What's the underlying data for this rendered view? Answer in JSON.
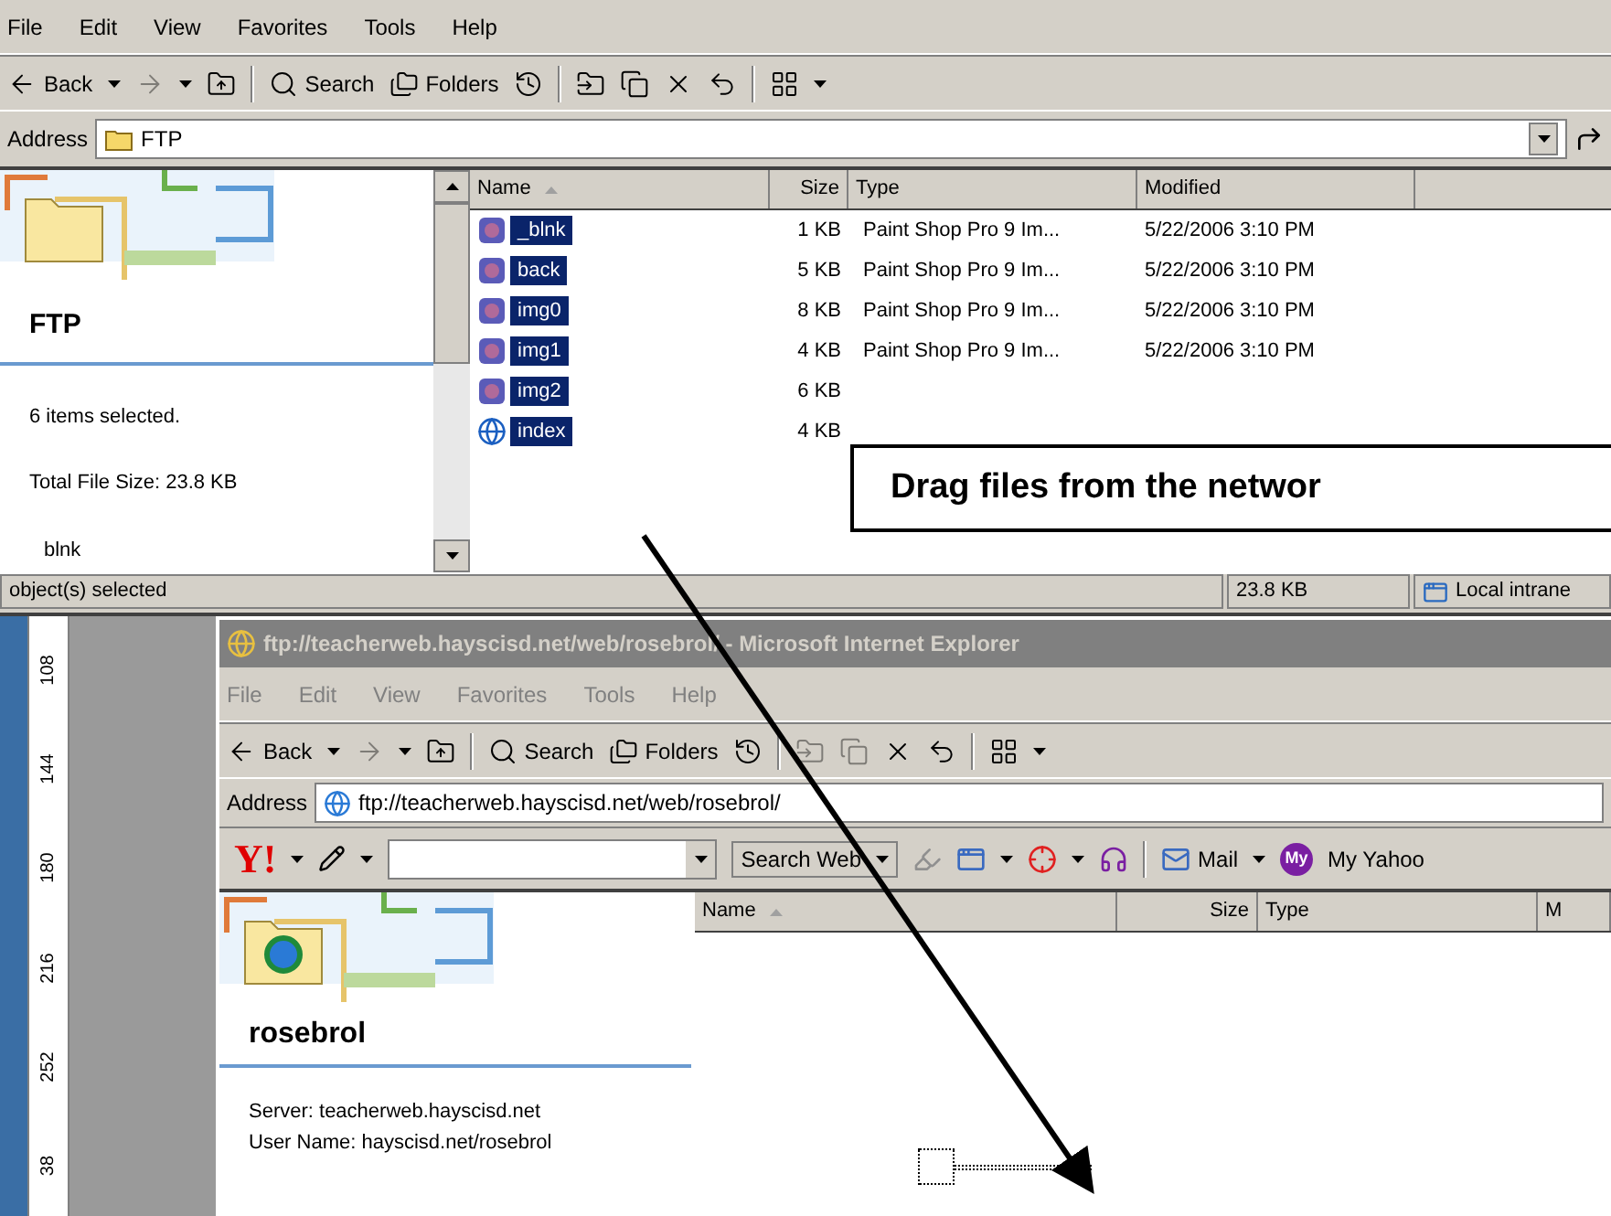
{
  "explorer": {
    "menu": [
      {
        "label": "File",
        "disabled": false
      },
      {
        "label": "Edit",
        "disabled": false
      },
      {
        "label": "View",
        "disabled": false
      },
      {
        "label": "Favorites",
        "disabled": false
      },
      {
        "label": "Tools",
        "disabled": false
      },
      {
        "label": "Help",
        "disabled": false
      }
    ],
    "toolbar": [
      {
        "kind": "back",
        "label": "Back",
        "disabled": false
      },
      {
        "kind": "forward",
        "disabled": true
      },
      {
        "kind": "up",
        "disabled": false
      },
      {
        "kind": "search",
        "label": "Search",
        "disabled": false
      },
      {
        "kind": "folders",
        "label": "Folders",
        "disabled": false
      },
      {
        "kind": "history",
        "disabled": false
      },
      {
        "kind": "move",
        "disabled": false
      },
      {
        "kind": "copy",
        "disabled": false
      },
      {
        "kind": "delete",
        "disabled": false
      },
      {
        "kind": "undo",
        "disabled": false
      },
      {
        "kind": "views",
        "disabled": false
      }
    ],
    "address": {
      "label": "Address",
      "value": "FTP"
    },
    "task_pane": {
      "title": "FTP",
      "details": [
        "6 items selected.",
        "Total File Size: 23.8 KB"
      ],
      "file_label": "blnk"
    },
    "file_list": {
      "columns": [
        {
          "label": "Name",
          "sorted": true
        },
        {
          "label": "Size",
          "sorted": false
        },
        {
          "label": "Type",
          "sorted": false
        },
        {
          "label": "Modified",
          "sorted": false
        }
      ],
      "rows": [
        {
          "kind": "image",
          "name": "_blnk",
          "size": "1 KB",
          "type": "Paint Shop Pro 9 Im...",
          "modified": "5/22/2006 3:10 PM",
          "selected": true
        },
        {
          "kind": "image",
          "name": "back",
          "size": "5 KB",
          "type": "Paint Shop Pro 9 Im...",
          "modified": "5/22/2006 3:10 PM",
          "selected": true
        },
        {
          "kind": "image",
          "name": "img0",
          "size": "8 KB",
          "type": "Paint Shop Pro 9 Im...",
          "modified": "5/22/2006 3:10 PM",
          "selected": true
        },
        {
          "kind": "image",
          "name": "img1",
          "size": "4 KB",
          "type": "Paint Shop Pro 9 Im...",
          "modified": "5/22/2006 3:10 PM",
          "selected": true
        },
        {
          "kind": "image",
          "name": "img2",
          "size": "6 KB",
          "selected": true
        },
        {
          "kind": "web",
          "name": "index",
          "size": "4 KB",
          "selected": true
        }
      ]
    },
    "status_bar": [
      "object(s) selected",
      "23.8 KB",
      "Local intrane"
    ]
  },
  "callout": "Drag files from the networ",
  "ruler": [
    "108",
    "144",
    "180",
    "216",
    "252",
    "38"
  ],
  "ie_window": {
    "title": "ftp://teacherweb.hayscisd.net/web/rosebrol/ - Microsoft Internet Explorer",
    "menu": [
      {
        "label": "File",
        "disabled": true
      },
      {
        "label": "Edit",
        "disabled": true
      },
      {
        "label": "View",
        "disabled": true
      },
      {
        "label": "Favorites",
        "disabled": true
      },
      {
        "label": "Tools",
        "disabled": true
      },
      {
        "label": "Help",
        "disabled": true
      }
    ],
    "toolbar": [
      {
        "kind": "back",
        "label": "Back",
        "disabled": false
      },
      {
        "kind": "forward",
        "disabled": true
      },
      {
        "kind": "up",
        "disabled": false
      },
      {
        "kind": "search",
        "label": "Search",
        "disabled": false
      },
      {
        "kind": "folders",
        "label": "Folders",
        "disabled": false
      },
      {
        "kind": "history",
        "disabled": false
      },
      {
        "kind": "move",
        "disabled": true
      },
      {
        "kind": "copy",
        "disabled": true
      },
      {
        "kind": "delete",
        "disabled": false
      },
      {
        "kind": "undo",
        "disabled": false
      },
      {
        "kind": "views",
        "disabled": false
      }
    ],
    "address": {
      "label": "Address",
      "value": "ftp://teacherweb.hayscisd.net/web/rosebrol/"
    },
    "yahoo_toolbar": {
      "logo": "Y!",
      "search_button": "Search Web",
      "mail": "Mail",
      "my_badge": "My",
      "my_yahoo": "My Yahoo"
    },
    "task_pane": {
      "title": "rosebrol",
      "details": [
        "Server: teacherweb.hayscisd.net",
        "User Name: hayscisd.net/rosebrol"
      ]
    },
    "file_list": {
      "columns": [
        {
          "label": "Name",
          "sorted": true
        },
        {
          "label": "Size",
          "sorted": false
        },
        {
          "label": "Type",
          "sorted": false
        },
        {
          "label": "M",
          "sorted": false
        }
      ]
    }
  }
}
